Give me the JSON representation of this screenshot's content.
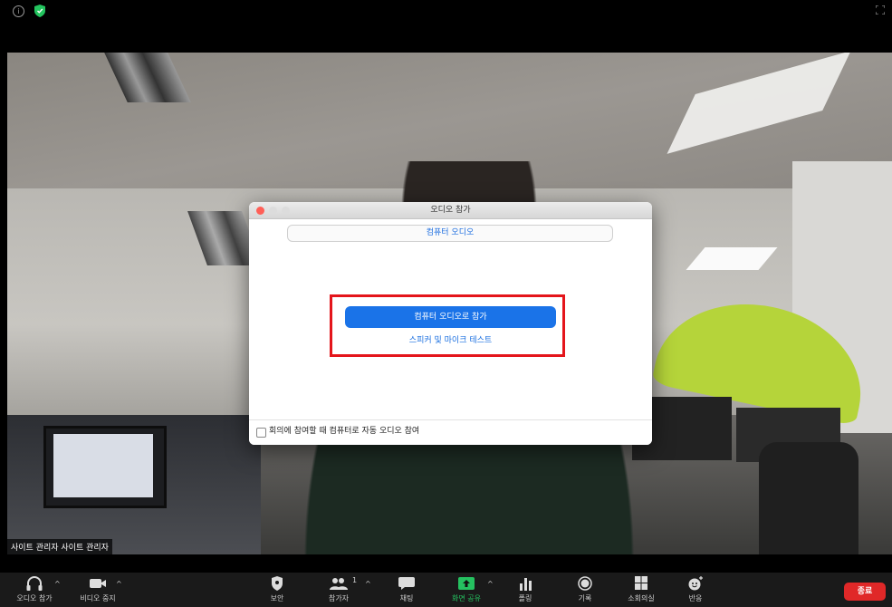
{
  "video": {
    "participant_name": "사이트 관리자 사이트 관리자"
  },
  "dialog": {
    "title": "오디오 참가",
    "tab_label": "컴퓨터 오디오",
    "join_button": "컴퓨터 오디오로 참가",
    "test_link": "스피커 및 마이크 테스트",
    "auto_join_label": "회의에 참여할 때 컴퓨터로 자동 오디오 참여",
    "auto_join_checked": false
  },
  "toolbar": {
    "join_audio": "오디오 참가",
    "stop_video": "비디오 중지",
    "security": "보안",
    "participants": "참가자",
    "participant_count": "1",
    "chat": "채팅",
    "share_screen": "화면 공유",
    "polling": "폴링",
    "record": "기록",
    "breakout_rooms": "소회의실",
    "reactions": "반응",
    "end": "종료"
  },
  "colors": {
    "accent": "#1a73e8",
    "share_green": "#25c160",
    "end_red": "#e02828",
    "highlight_red": "#e4151b"
  }
}
